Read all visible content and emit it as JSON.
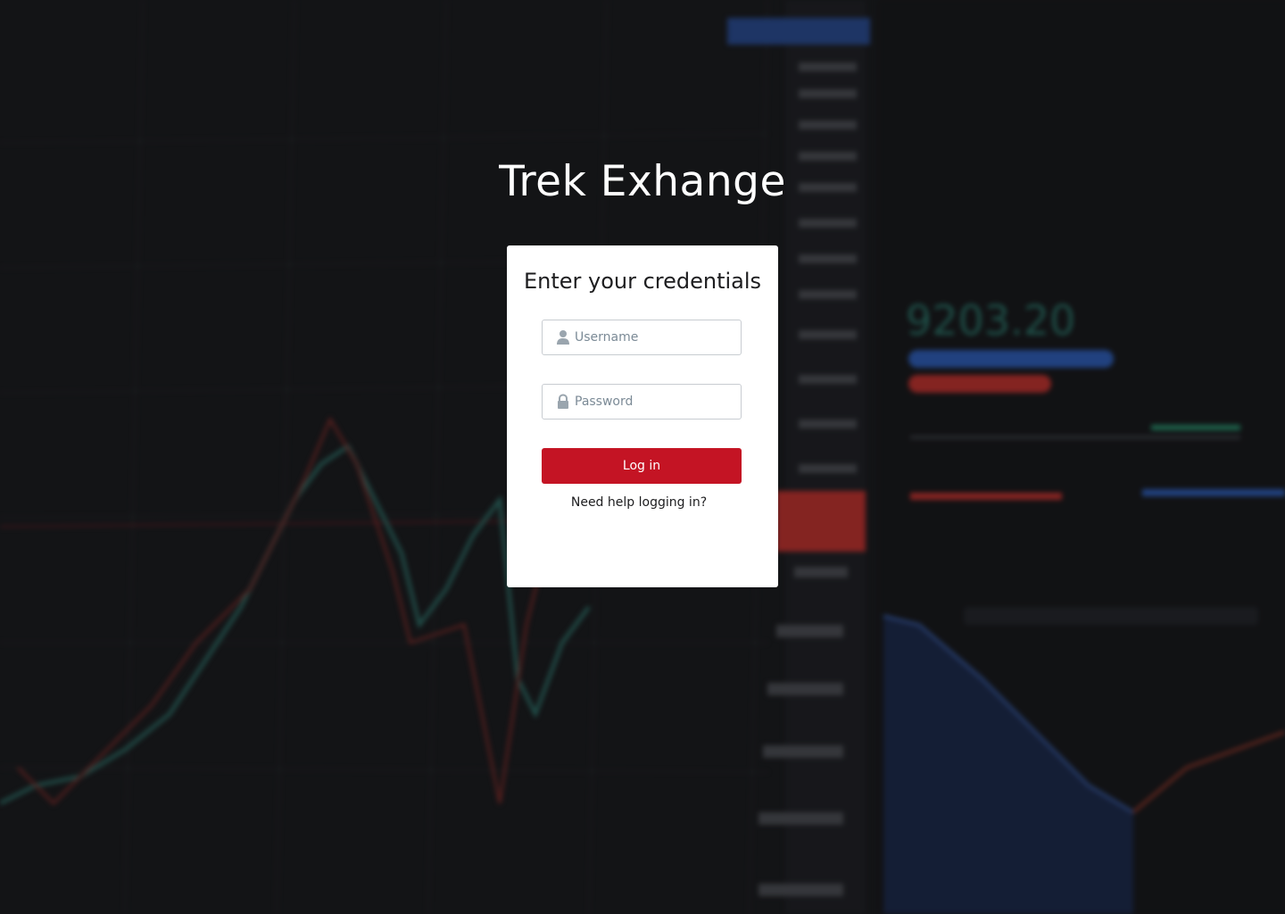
{
  "app": {
    "title": "Trek Exhange"
  },
  "login": {
    "heading": "Enter your credentials",
    "username_placeholder": "Username",
    "username_value": "",
    "password_placeholder": "Password",
    "password_value": "",
    "submit_label": "Log in",
    "help_link": "Need help logging in?"
  },
  "icons": {
    "username": "user-icon",
    "password": "lock-icon"
  },
  "colors": {
    "primary_button": "#c41424",
    "background": "#1b1c1f",
    "card": "#ffffff"
  }
}
